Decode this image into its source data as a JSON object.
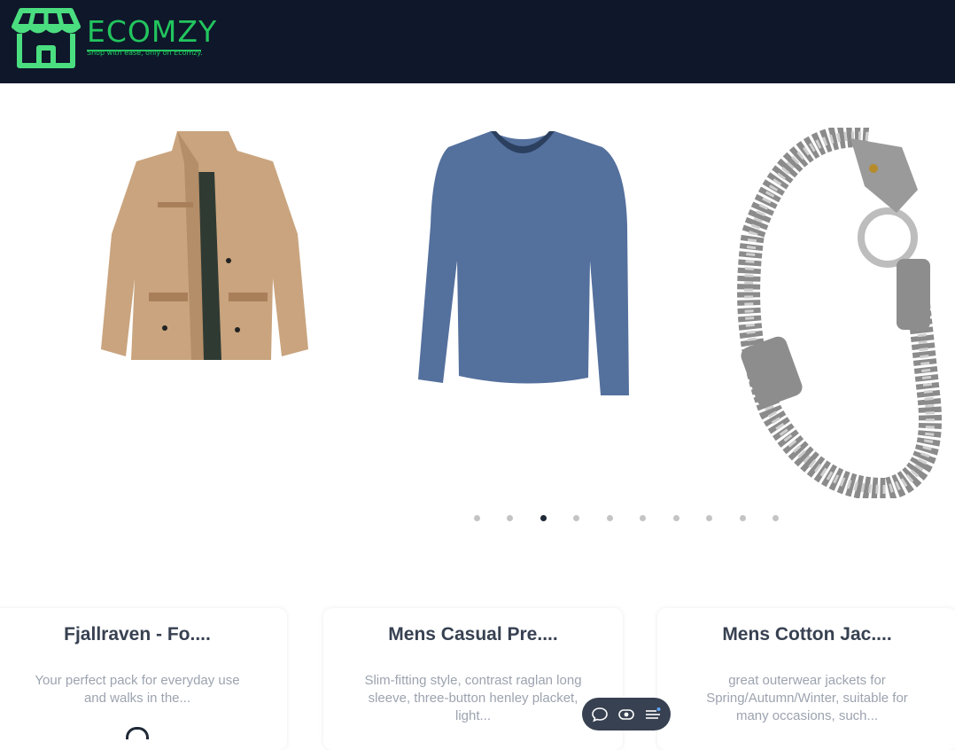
{
  "header": {
    "brand_name": "ECOMZY",
    "brand_tagline": "Shop with ease, only on Ecomzy.",
    "brand_color": "#22c55e",
    "background": "#0f172a"
  },
  "carousel": {
    "slides": [
      {
        "name": "Tan jacket",
        "icon": "jacket-image"
      },
      {
        "name": "Blue long sleeve shirt",
        "icon": "shirt-image"
      },
      {
        "name": "Silver dragon bracelet",
        "icon": "bracelet-image"
      }
    ],
    "dot_count": 10,
    "active_dot": 3
  },
  "products": [
    {
      "title": "Fjallraven - Fo....",
      "description": "Your perfect pack for everyday use and walks in the..."
    },
    {
      "title": "Mens Casual Pre....",
      "description": "Slim-fitting style, contrast raglan long sleeve, three-button henley placket, light..."
    },
    {
      "title": "Mens Cotton Jac....",
      "description": "great outerwear jackets for Spring/Autumn/Winter, suitable for many occasions, such..."
    }
  ],
  "toolbar": {
    "icons": [
      "chat-icon",
      "eye-icon",
      "menu-icon"
    ]
  }
}
